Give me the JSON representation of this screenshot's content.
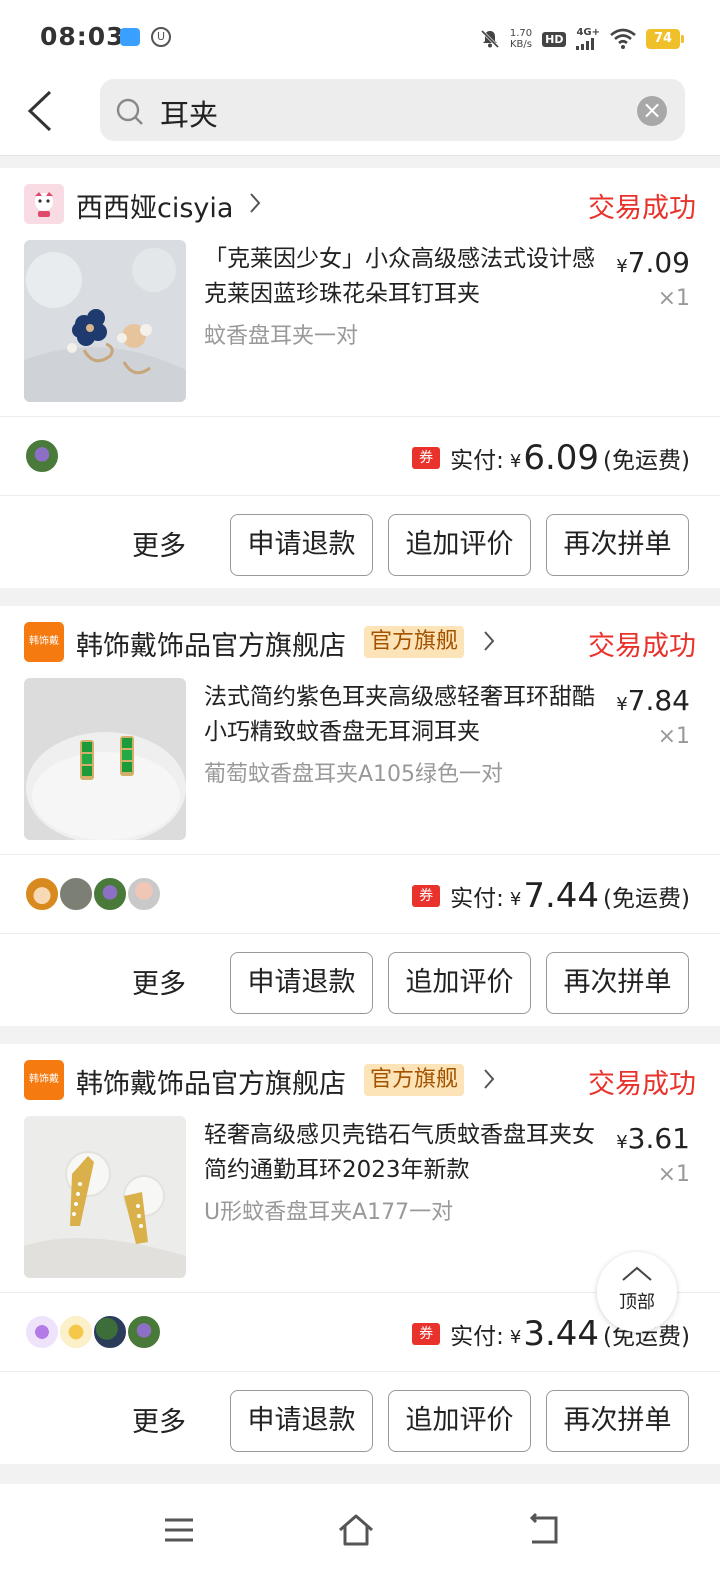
{
  "status_bar": {
    "time": "08:03",
    "net_speed_value": "1.70",
    "net_speed_unit": "KB/s",
    "hd_label": "HD",
    "signal_label": "4G+",
    "battery": "74"
  },
  "search": {
    "query": "耳夹",
    "back_icon": "chevron-left-icon",
    "search_icon": "search-icon",
    "clear_icon": "close-circle-icon"
  },
  "orders": [
    {
      "shop_name": "西西娅cisyia",
      "shop_tag": "",
      "shop_logo_text": "",
      "status": "交易成功",
      "product_title": "「克莱因少女」小众高级感法式设计感克莱因蓝珍珠花朵耳钉耳夹",
      "product_spec": "蚊香盘耳夹一对",
      "price_yen": "¥",
      "price": "7.09",
      "quantity": "×1",
      "coupon": "券",
      "paid_label": "实付:",
      "paid_yen": "¥",
      "paid_amount": "6.09",
      "shipping": "(免运费)"
    },
    {
      "shop_name": "韩饰戴饰品官方旗舰店",
      "shop_tag": "官方旗舰",
      "shop_logo_text": "韩饰戴",
      "status": "交易成功",
      "product_title": "法式简约紫色耳夹高级感轻奢耳环甜酷小巧精致蚊香盘无耳洞耳夹",
      "product_spec": "葡萄蚊香盘耳夹A105绿色一对",
      "price_yen": "¥",
      "price": "7.84",
      "quantity": "×1",
      "coupon": "券",
      "paid_label": "实付:",
      "paid_yen": "¥",
      "paid_amount": "7.44",
      "shipping": "(免运费)"
    },
    {
      "shop_name": "韩饰戴饰品官方旗舰店",
      "shop_tag": "官方旗舰",
      "shop_logo_text": "韩饰戴",
      "status": "交易成功",
      "product_title": "轻奢高级感贝壳锆石气质蚊香盘耳夹女简约通勤耳环2023年新款",
      "product_spec": "U形蚊香盘耳夹A177一对",
      "price_yen": "¥",
      "price": "3.61",
      "quantity": "×1",
      "coupon": "券",
      "paid_label": "实付:",
      "paid_yen": "¥",
      "paid_amount": "3.44",
      "shipping": "(免运费)"
    }
  ],
  "actions": {
    "more": "更多",
    "refund": "申请退款",
    "add_review": "追加评价",
    "reorder": "再次拼单"
  },
  "back_to_top": "顶部",
  "colors": {
    "accent_red": "#e8322b",
    "tag_bg": "#fde4b8",
    "tag_text": "#a35300",
    "battery": "#f0c02a"
  }
}
